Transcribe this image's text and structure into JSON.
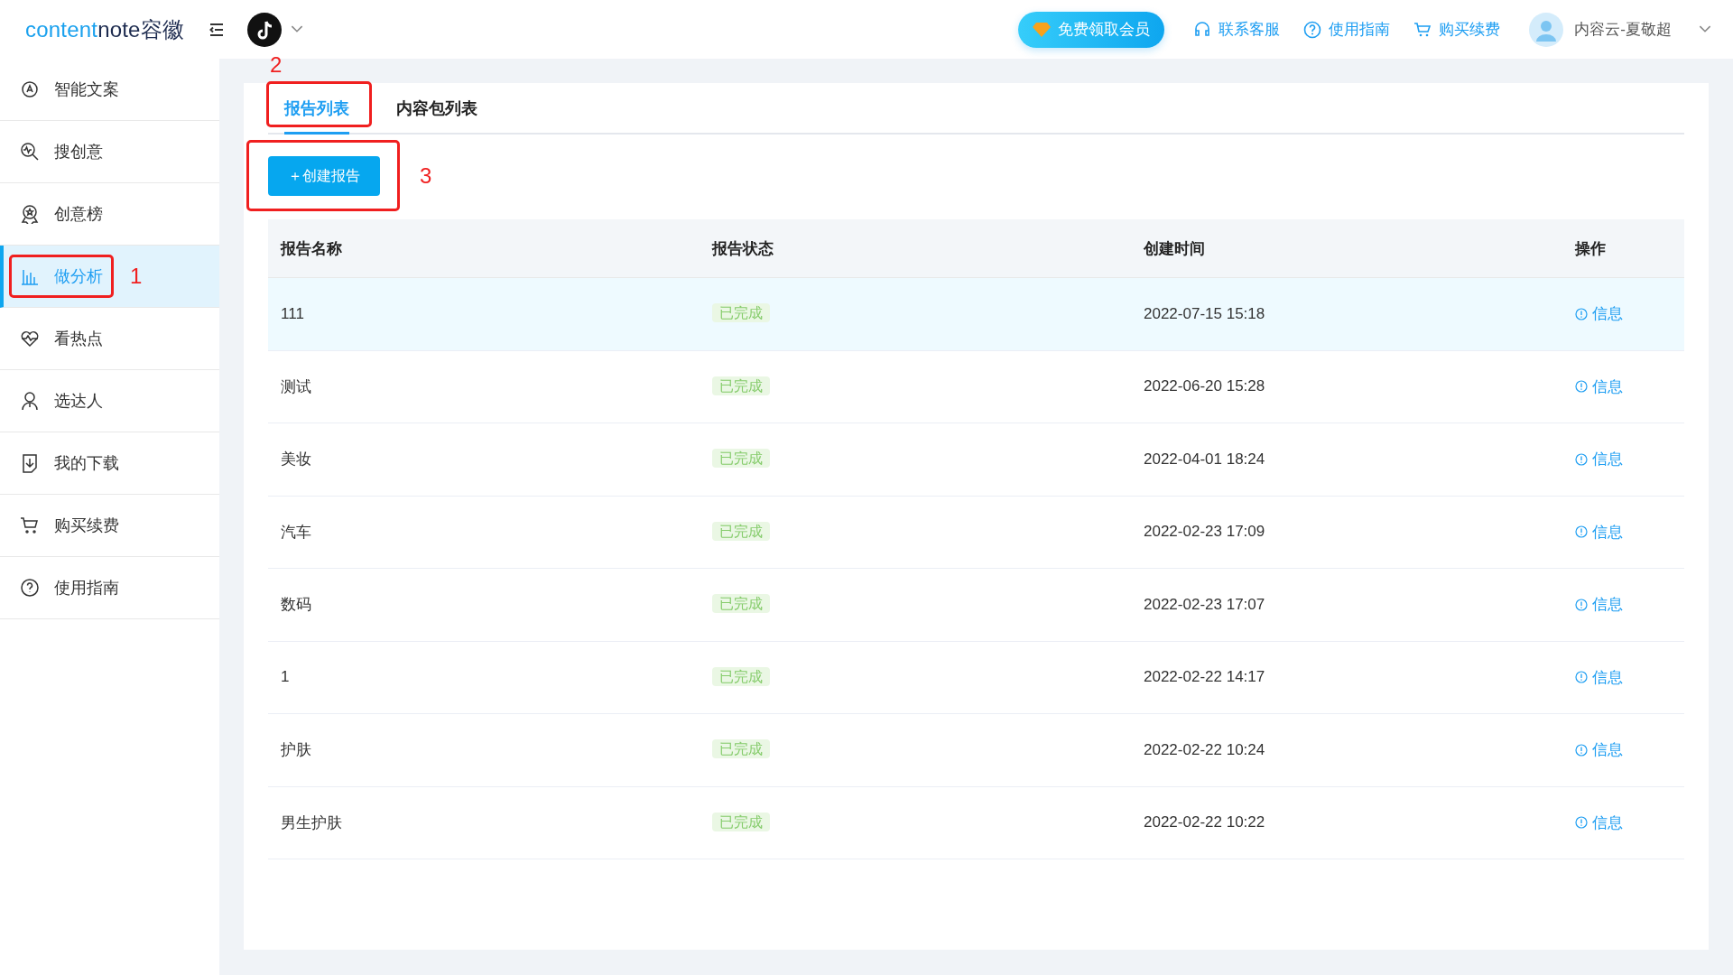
{
  "logo": {
    "accent": "content",
    "rest": "note容徽"
  },
  "header": {
    "vip_button": "免费领取会员",
    "links": [
      "联系客服",
      "使用指南",
      "购买续费"
    ],
    "user": "内容云-夏敬超"
  },
  "sidebar": {
    "items": [
      {
        "label": "智能文案",
        "selected": false
      },
      {
        "label": "搜创意",
        "selected": false
      },
      {
        "label": "创意榜",
        "selected": false
      },
      {
        "label": "做分析",
        "selected": true,
        "annotation": "1"
      },
      {
        "label": "看热点",
        "selected": false
      },
      {
        "label": "选达人",
        "selected": false
      },
      {
        "label": "我的下载",
        "selected": false
      },
      {
        "label": "购买续费",
        "selected": false
      },
      {
        "label": "使用指南",
        "selected": false
      }
    ]
  },
  "tabs": [
    {
      "label": "报告列表",
      "selected": true,
      "annotation": "2"
    },
    {
      "label": "内容包列表",
      "selected": false
    }
  ],
  "create_button": {
    "label": "＋创建报告",
    "annotation": "3"
  },
  "table": {
    "columns": [
      "报告名称",
      "报告状态",
      "创建时间",
      "操作"
    ],
    "rows": [
      {
        "name": "111",
        "status": "已完成",
        "time": "2022-07-15 15:18",
        "action": "信息",
        "highlighted": true
      },
      {
        "name": "测试",
        "status": "已完成",
        "time": "2022-06-20 15:28",
        "action": "信息",
        "highlighted": false
      },
      {
        "name": "美妆",
        "status": "已完成",
        "time": "2022-04-01 18:24",
        "action": "信息",
        "highlighted": false
      },
      {
        "name": "汽车",
        "status": "已完成",
        "time": "2022-02-23 17:09",
        "action": "信息",
        "highlighted": false
      },
      {
        "name": "数码",
        "status": "已完成",
        "time": "2022-02-23 17:07",
        "action": "信息",
        "highlighted": false
      },
      {
        "name": "1",
        "status": "已完成",
        "time": "2022-02-22 14:17",
        "action": "信息",
        "highlighted": false
      },
      {
        "name": "护肤",
        "status": "已完成",
        "time": "2022-02-22 10:24",
        "action": "信息",
        "highlighted": false
      },
      {
        "name": "男生护肤",
        "status": "已完成",
        "time": "2022-02-22 10:22",
        "action": "信息",
        "highlighted": false
      }
    ]
  }
}
